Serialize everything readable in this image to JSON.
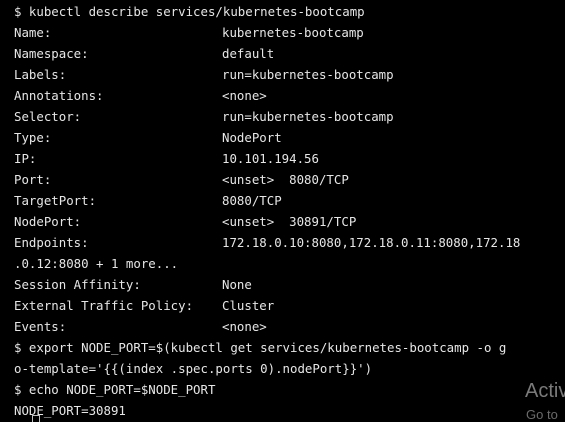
{
  "terminal": {
    "command1": "$ kubectl describe services/kubernetes-bootcamp",
    "fields": [
      {
        "key": "Name:",
        "value": "kubernetes-bootcamp"
      },
      {
        "key": "Namespace:",
        "value": "default"
      },
      {
        "key": "Labels:",
        "value": "run=kubernetes-bootcamp"
      },
      {
        "key": "Annotations:",
        "value": "<none>"
      },
      {
        "key": "Selector:",
        "value": "run=kubernetes-bootcamp"
      },
      {
        "key": "Type:",
        "value": "NodePort"
      },
      {
        "key": "IP:",
        "value": "10.101.194.56"
      },
      {
        "key": "Port:",
        "value": "<unset>  8080/TCP"
      },
      {
        "key": "TargetPort:",
        "value": "8080/TCP"
      },
      {
        "key": "NodePort:",
        "value": "<unset>  30891/TCP"
      },
      {
        "key": "Endpoints:",
        "value": "172.18.0.10:8080,172.18.0.11:8080,172.18"
      },
      {
        "key": "Session Affinity:",
        "value": "None"
      },
      {
        "key": "External Traffic Policy:",
        "value": "Cluster"
      },
      {
        "key": "Events:",
        "value": "<none>"
      }
    ],
    "endpoints_continuation": ".0.12:8080 + 1 more...",
    "command2_line1": "$ export NODE_PORT=$(kubectl get services/kubernetes-bootcamp -o g",
    "command2_line2": "o-template='{{(index .spec.ports 0).nodePort}}')",
    "command3": "$ echo NODE_PORT=$NODE_PORT",
    "output3": "NODE_PORT=30891"
  },
  "watermark": {
    "title": "Activ",
    "subtitle": "Go to"
  }
}
